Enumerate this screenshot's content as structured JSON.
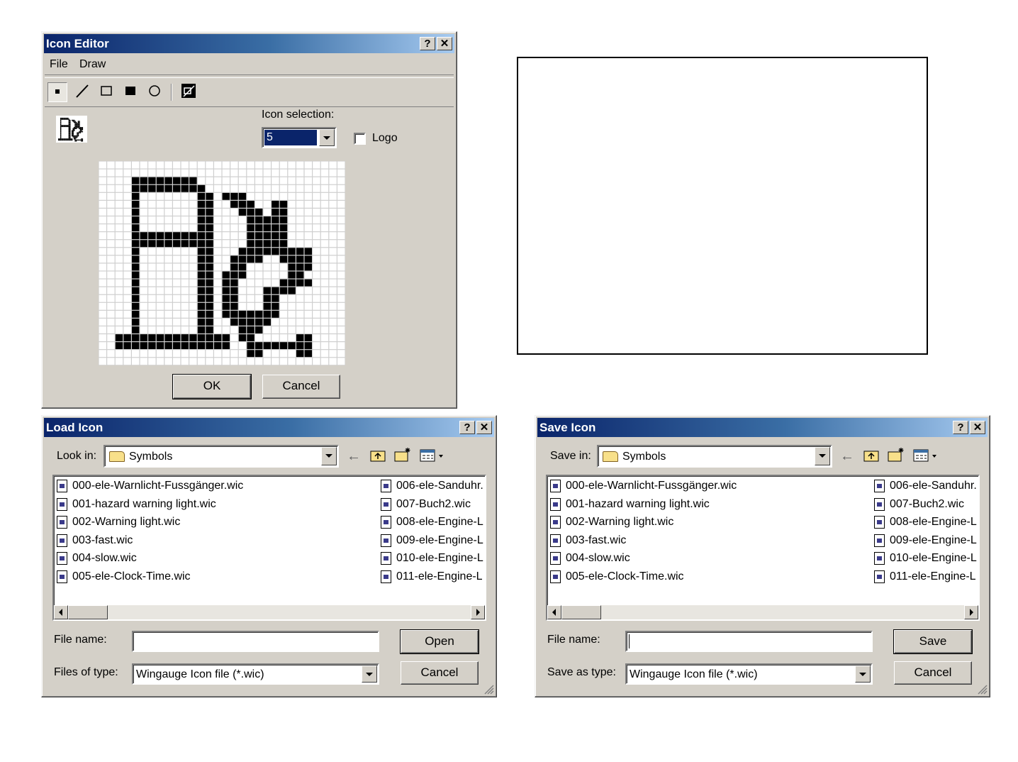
{
  "editor": {
    "title": "Icon Editor",
    "help": "?",
    "close": "✕",
    "menu": [
      "File",
      "Draw"
    ],
    "tools": [
      "pixel-tool",
      "line-tool",
      "rect-outline-tool",
      "rect-filled-tool",
      "ellipse-tool",
      "invert-tool"
    ],
    "selection_label": "Icon selection:",
    "selection_value": "5",
    "logo_label": "Logo",
    "logo_checked": false,
    "ok": "OK",
    "cancel": "Cancel",
    "grid_rows": [
      "000000000000000000000000000000",
      "000000000000000000000000000000",
      "000011111111000000000000000000",
      "000011111111100000000000000000",
      "000010000000110111000000000000",
      "000010000000110011100110000000",
      "000010000000110001110110000000",
      "000010000000110000111110000000",
      "000010000000110000111110000000",
      "000011111111110000111110000000",
      "000011111111110000111110000000",
      "000010000000110001111111110000",
      "000010000000110011110011110000",
      "000010000000110011000001110000",
      "000010000000110111000001100000",
      "000010000000110110000011110000",
      "000010000000110110001111000000",
      "000010000000110110001100000000",
      "000010000000110110001100000000",
      "000010000000110111111100000000",
      "000010000000110011111000000000",
      "000010000000110001110000000000",
      "001111111111111101100000110000",
      "001111111111111100111111110000",
      "000000000000000000110000110000",
      "000000000000000000000000000000"
    ]
  },
  "load": {
    "title": "Load Icon",
    "help": "?",
    "close": "✕",
    "lookin_label": "Look in:",
    "lookin_value": "Symbols",
    "files_left": [
      "000-ele-Warnlicht-Fussgänger.wic",
      "001-hazard warning light.wic",
      "002-Warning light.wic",
      "003-fast.wic",
      "004-slow.wic",
      "005-ele-Clock-Time.wic"
    ],
    "files_right": [
      "006-ele-Sanduhr.",
      "007-Buch2.wic",
      "008-ele-Engine-L",
      "009-ele-Engine-L",
      "010-ele-Engine-L",
      "011-ele-Engine-L"
    ],
    "filename_label": "File name:",
    "filename_value": "",
    "type_label": "Files of type:",
    "type_value": "Wingauge Icon file (*.wic)",
    "primary": "Open",
    "cancel": "Cancel"
  },
  "save": {
    "title": "Save Icon",
    "help": "?",
    "close": "✕",
    "lookin_label": "Save in:",
    "lookin_value": "Symbols",
    "files_left": [
      "000-ele-Warnlicht-Fussgänger.wic",
      "001-hazard warning light.wic",
      "002-Warning light.wic",
      "003-fast.wic",
      "004-slow.wic",
      "005-ele-Clock-Time.wic"
    ],
    "files_right": [
      "006-ele-Sanduhr.",
      "007-Buch2.wic",
      "008-ele-Engine-L",
      "009-ele-Engine-L",
      "010-ele-Engine-L",
      "011-ele-Engine-L"
    ],
    "filename_label": "File name:",
    "filename_value": "",
    "type_label": "Save as type:",
    "type_value": "Wingauge Icon file (*.wic)",
    "primary": "Save",
    "cancel": "Cancel"
  }
}
